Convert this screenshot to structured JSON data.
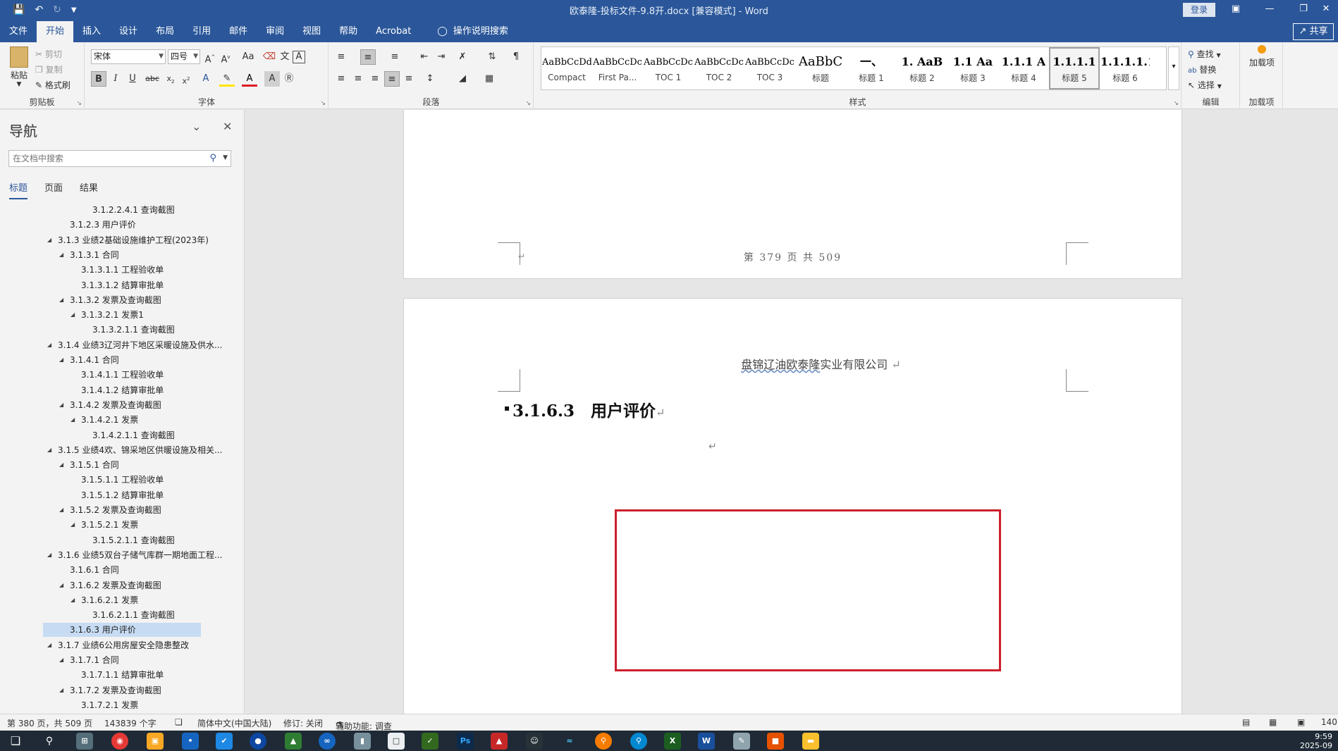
{
  "titlebar": {
    "title": "欧泰隆-投标文件-9.8开.docx [兼容模式]  -  Word",
    "login": "登录",
    "icons": [
      "save-icon",
      "undo-icon",
      "redo-icon",
      "customize-icon"
    ]
  },
  "tabs": [
    "文件",
    "开始",
    "插入",
    "设计",
    "布局",
    "引用",
    "邮件",
    "审阅",
    "视图",
    "帮助",
    "Acrobat"
  ],
  "active_tab": "开始",
  "tell_me": "操作说明搜索",
  "share": "共享",
  "ribbon": {
    "clipboard": {
      "paste": "粘贴",
      "cut": "剪切",
      "copy": "复制",
      "format_painter": "格式刷",
      "label": "剪贴板"
    },
    "font": {
      "name": "宋体",
      "size": "四号",
      "label": "字体",
      "case": "Aa"
    },
    "paragraph": {
      "label": "段落"
    },
    "styles": {
      "label": "样式",
      "items": [
        {
          "sample": "AaBbCcDd",
          "name": "Compact"
        },
        {
          "sample": "AaBbCcDс",
          "name": "First Pa..."
        },
        {
          "sample": "AaBbCcDс",
          "name": "TOC 1"
        },
        {
          "sample": "AaBbCcDс",
          "name": "TOC 2"
        },
        {
          "sample": "AaBbCcDс",
          "name": "TOC 3"
        },
        {
          "sample": "AaBbC",
          "name": "标题"
        },
        {
          "sample": "一、",
          "name": "标题 1"
        },
        {
          "sample": "1. AaB",
          "name": "标题 2"
        },
        {
          "sample": "1.1 Aa",
          "name": "标题 3"
        },
        {
          "sample": "1.1.1 A",
          "name": "标题 4"
        },
        {
          "sample": "1.1.1.1",
          "name": "标题 5"
        },
        {
          "sample": "1.1.1.1.1",
          "name": "标题 6"
        }
      ],
      "selected": "标题 5"
    },
    "editing": {
      "find": "查找",
      "replace": "替换",
      "select": "选择",
      "label": "编辑"
    },
    "addins": {
      "button": "加载项",
      "label": "加载项"
    }
  },
  "nav": {
    "title": "导航",
    "search_placeholder": "在文档中搜索",
    "tabs": [
      "标题",
      "页面",
      "结果"
    ],
    "active_tab": "标题",
    "items": [
      {
        "text": "3.1.2.2.4.1 查询截图",
        "level": 4,
        "tri": false
      },
      {
        "text": "3.1.2.3 用户评价",
        "level": 2,
        "tri": false
      },
      {
        "text": "3.1.3 业绩2基础设施维护工程(2023年)",
        "level": 1,
        "tri": true
      },
      {
        "text": "3.1.3.1 合同",
        "level": 2,
        "tri": true
      },
      {
        "text": "3.1.3.1.1 工程验收单",
        "level": 3,
        "tri": false
      },
      {
        "text": "3.1.3.1.2 结算审批单",
        "level": 3,
        "tri": false
      },
      {
        "text": "3.1.3.2 发票及查询截图",
        "level": 2,
        "tri": true
      },
      {
        "text": "3.1.3.2.1 发票1",
        "level": 3,
        "tri": true
      },
      {
        "text": "3.1.3.2.1.1 查询截图",
        "level": 4,
        "tri": false
      },
      {
        "text": "3.1.4 业绩3辽河井下地区采暖设施及供水...",
        "level": 1,
        "tri": true
      },
      {
        "text": "3.1.4.1 合同",
        "level": 2,
        "tri": true
      },
      {
        "text": "3.1.4.1.1 工程验收单",
        "level": 3,
        "tri": false
      },
      {
        "text": "3.1.4.1.2 结算审批单",
        "level": 3,
        "tri": false
      },
      {
        "text": "3.1.4.2 发票及查询截图",
        "level": 2,
        "tri": true
      },
      {
        "text": "3.1.4.2.1 发票",
        "level": 3,
        "tri": true
      },
      {
        "text": "3.1.4.2.1.1 查询截图",
        "level": 4,
        "tri": false
      },
      {
        "text": "3.1.5 业绩4欢、锦采地区供暖设施及相关...",
        "level": 1,
        "tri": true
      },
      {
        "text": "3.1.5.1 合同",
        "level": 2,
        "tri": true
      },
      {
        "text": "3.1.5.1.1 工程验收单",
        "level": 3,
        "tri": false
      },
      {
        "text": "3.1.5.1.2 结算审批单",
        "level": 3,
        "tri": false
      },
      {
        "text": "3.1.5.2 发票及查询截图",
        "level": 2,
        "tri": true
      },
      {
        "text": "3.1.5.2.1 发票",
        "level": 3,
        "tri": true
      },
      {
        "text": "3.1.5.2.1.1 查询截图",
        "level": 4,
        "tri": false
      },
      {
        "text": "3.1.6 业绩5双台子储气库群一期地面工程...",
        "level": 1,
        "tri": true
      },
      {
        "text": "3.1.6.1 合同",
        "level": 2,
        "tri": false
      },
      {
        "text": "3.1.6.2 发票及查询截图",
        "level": 2,
        "tri": true
      },
      {
        "text": "3.1.6.2.1 发票",
        "level": 3,
        "tri": true
      },
      {
        "text": "3.1.6.2.1.1 查询截图",
        "level": 4,
        "tri": false
      },
      {
        "text": "3.1.6.3 用户评价",
        "level": 2,
        "tri": false,
        "current": true
      },
      {
        "text": "3.1.7 业绩6公用房屋安全隐患整改",
        "level": 1,
        "tri": true
      },
      {
        "text": "3.1.7.1 合同",
        "level": 2,
        "tri": true
      },
      {
        "text": "3.1.7.1.1 结算审批单",
        "level": 3,
        "tri": false
      },
      {
        "text": "3.1.7.2 发票及查询截图",
        "level": 2,
        "tri": true
      },
      {
        "text": "3.1.7.2.1 发票",
        "level": 3,
        "tri": false
      }
    ]
  },
  "document": {
    "page_footer": "第 379 页 共 509",
    "company_underlined": "盘锦辽油欧泰隆",
    "company_rest": "实业有限公司",
    "heading": "3.1.6.3　用户评价"
  },
  "status": {
    "page": "第 380 页，共 509 页",
    "words": "143839 个字",
    "language": "简体中文(中国大陆)",
    "track": "修订: 关闭",
    "accessibility": "辅助功能: 调查",
    "zoom": "140"
  },
  "taskbar": {
    "time": "9:59",
    "date": "2025-09"
  }
}
